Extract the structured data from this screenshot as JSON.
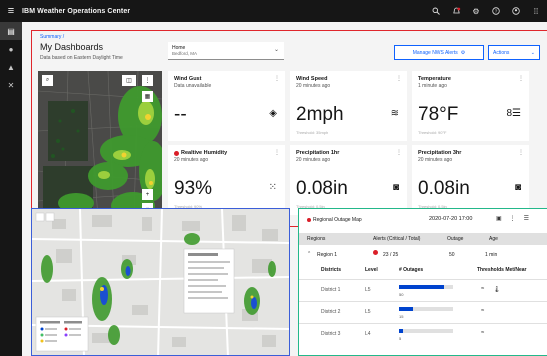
{
  "app": {
    "title": "IBM Weather Operations Center"
  },
  "topbar_icons": [
    "search-icon",
    "notification-icon",
    "settings-icon",
    "help-icon",
    "user-icon",
    "app-switcher-icon"
  ],
  "sidenav": [
    "dashboard-icon",
    "globe-icon",
    "alert-icon",
    "tools-icon"
  ],
  "header": {
    "breadcrumb": "Summary  /",
    "title": "My Dashboards",
    "subtitle": "Data based on Eastern Daylight Time",
    "location_label": "Home",
    "location_value": "Bedford, MA",
    "alerts_button": "Manage NWS Alerts",
    "actions_button": "Actions"
  },
  "cards": [
    {
      "title": "Wind Gust",
      "subtitle": "Data unavailable",
      "value": "--",
      "threshold": "",
      "icon": "diamond-warning-icon",
      "alert": false
    },
    {
      "title": "Wind Speed",
      "subtitle": "20 minutes ago",
      "value": "2mph",
      "threshold": "Threshold: 35mph",
      "icon": "wind-icon",
      "alert": false
    },
    {
      "title": "Temperature",
      "subtitle": "1 minute ago",
      "value": "78°F",
      "threshold": "Threshold: 90°F",
      "icon": "thermometer-icon",
      "alert": false
    },
    {
      "title": "Realtive Humidity",
      "subtitle": "20 minutes ago",
      "value": "93%",
      "threshold": "Threshold: 90%",
      "icon": "humidity-icon",
      "alert": true
    },
    {
      "title": "Precipitation 1hr",
      "subtitle": "20 minutes ago",
      "value": "0.08in",
      "threshold": "Threshold: 0.5in",
      "icon": "rain-gauge-icon",
      "alert": false
    },
    {
      "title": "Precipitation 3hr",
      "subtitle": "20 minutes ago",
      "value": "0.08in",
      "threshold": "Threshold: 0.5in",
      "icon": "rain-gauge-icon",
      "alert": false
    }
  ],
  "outage": {
    "title": "Regional Outage Map",
    "datetime": "2020-07-20 17:00",
    "columns": [
      "Regions",
      "Alerts (Critical / Total)",
      "Outage",
      "Age"
    ],
    "region": {
      "name": "Region 1",
      "alerts": "23 / 25",
      "outage": "50",
      "age": "1 min"
    },
    "sub_columns": [
      "Districts",
      "Level",
      "# Outages",
      "Thresholds Met/Near"
    ],
    "districts": [
      {
        "name": "District 1",
        "level": "L5",
        "outages": "50",
        "fraction": 0.84
      },
      {
        "name": "District 2",
        "level": "L5",
        "outages": "15",
        "fraction": 0.26
      },
      {
        "name": "District 3",
        "level": "L4",
        "outages": "5",
        "fraction": 0.08
      }
    ]
  },
  "colors": {
    "accent": "#0f62fe",
    "alert": "#da1e28",
    "border_red": "#e0262c",
    "border_blue": "#3b5ed8",
    "border_green": "#23b88a"
  }
}
